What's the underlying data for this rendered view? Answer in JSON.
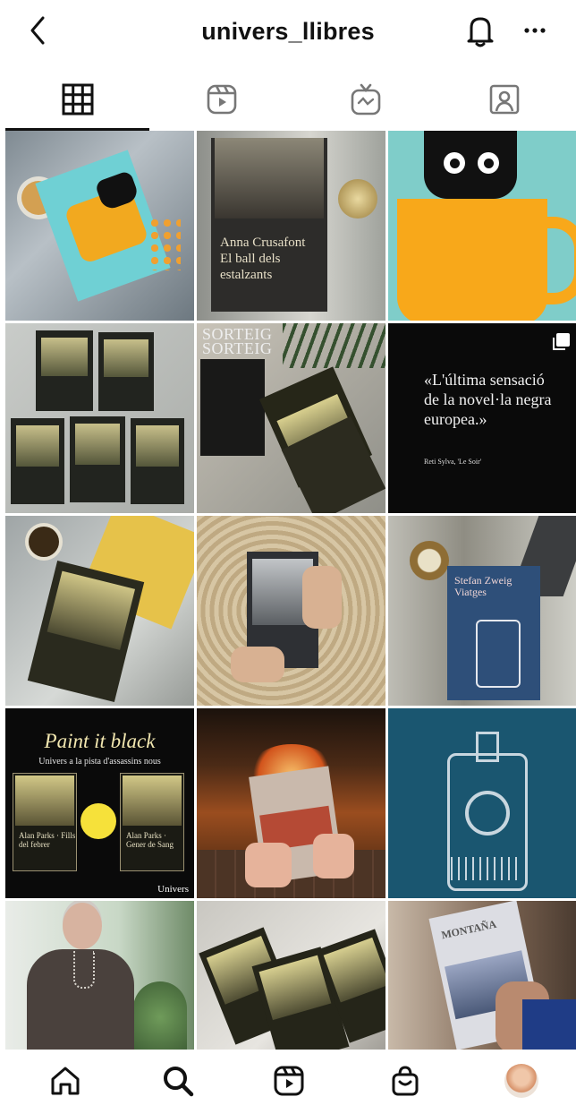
{
  "header": {
    "username": "univers_llibres",
    "icons": [
      "back-icon",
      "bell-icon",
      "more-icon"
    ]
  },
  "tabs": [
    {
      "name": "grid",
      "active": true
    },
    {
      "name": "reels",
      "active": false
    },
    {
      "name": "igtv",
      "active": false
    },
    {
      "name": "tagged",
      "active": false
    }
  ],
  "posts": {
    "t2": {
      "author": "Anna Crusafont",
      "title": "El ball dels estalzants"
    },
    "t5": {
      "label1": "SORTEIG",
      "label2": "SORTEIG"
    },
    "t6": {
      "quote": "«L'última sensació de la novel·la negra europea.»",
      "cite": "Reti Sylva, 'Le Soir'"
    },
    "t9": {
      "author": "Stefan Zweig",
      "title": "Viatges"
    },
    "t10": {
      "title": "Paint it black",
      "subtitle": "Univers a la pista d'assassins nous",
      "book1": "Alan Parks · Fills del febrer",
      "book2": "Alan Parks · Gener de Sang",
      "brand": "Univers"
    },
    "t15": {
      "title": "MONTAÑA"
    }
  },
  "bottom_nav": [
    "home-icon",
    "search-icon",
    "reels-icon",
    "shop-icon",
    "profile-avatar"
  ]
}
